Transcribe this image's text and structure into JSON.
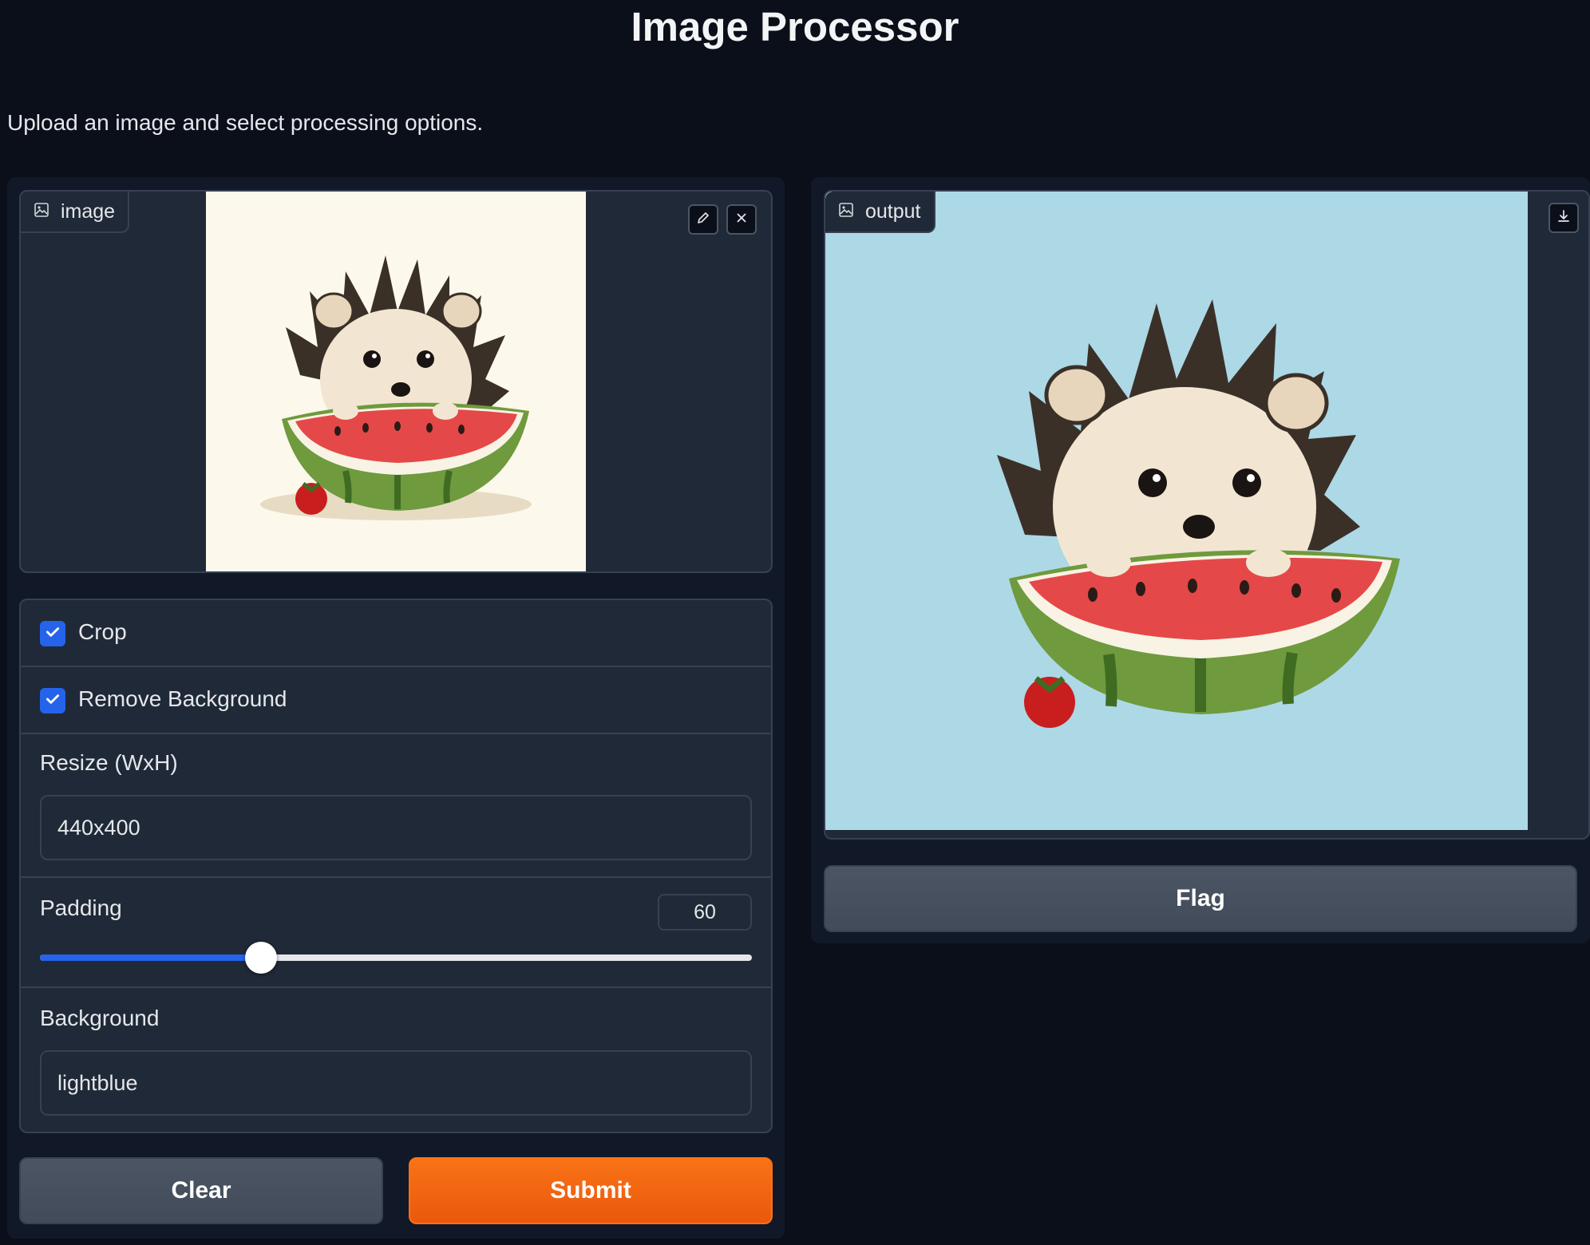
{
  "page": {
    "title": "Image Processor",
    "description": "Upload an image and select processing options."
  },
  "input_image": {
    "label": "image",
    "icon": "image-icon",
    "edit_icon": "pencil-icon",
    "clear_icon": "close-icon",
    "background_color": "#fdf8ec"
  },
  "options": {
    "crop": {
      "label": "Crop",
      "checked": true
    },
    "remove_background": {
      "label": "Remove Background",
      "checked": true
    },
    "resize": {
      "label": "Resize (WxH)",
      "value": "440x400"
    },
    "padding": {
      "label": "Padding",
      "value": "60",
      "slider_fraction": 0.31
    },
    "background": {
      "label": "Background",
      "value": "lightblue"
    }
  },
  "buttons": {
    "clear": "Clear",
    "submit": "Submit",
    "flag": "Flag"
  },
  "output_image": {
    "label": "output",
    "icon": "image-icon",
    "download_icon": "download-icon",
    "background_color": "#add8e6"
  },
  "colors": {
    "accent": "#2563eb",
    "primary_button": "#f97316",
    "panel": "#1f2937",
    "page_bg": "#0b0f19"
  }
}
